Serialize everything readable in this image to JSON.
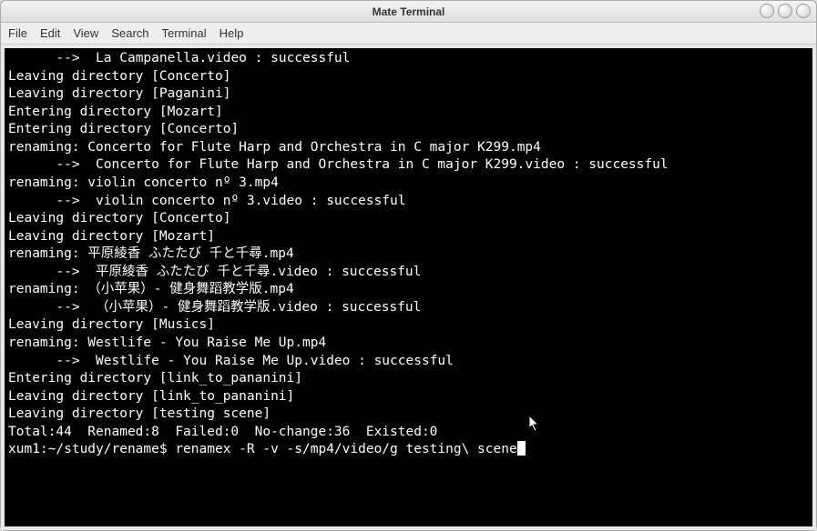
{
  "window": {
    "title": "Mate Terminal"
  },
  "menubar": {
    "file": "File",
    "edit": "Edit",
    "view": "View",
    "search": "Search",
    "terminal": "Terminal",
    "help": "Help"
  },
  "terminal": {
    "lines": [
      "      -->  La Campanella.video : successful",
      "Leaving directory [Concerto]",
      "Leaving directory [Paganini]",
      "Entering directory [Mozart]",
      "Entering directory [Concerto]",
      "renaming: Concerto for Flute Harp and Orchestra in C major K299.mp4",
      "      -->  Concerto for Flute Harp and Orchestra in C major K299.video : successful",
      "renaming: violin concerto nº 3.mp4",
      "      -->  violin concerto nº 3.video : successful",
      "Leaving directory [Concerto]",
      "Leaving directory [Mozart]",
      "renaming: 平原綾香 ふたたび 千と千尋.mp4",
      "      -->  平原綾香 ふたたび 千と千尋.video : successful",
      "renaming: （小苹果）- 健身舞蹈教学版.mp4",
      "      -->  （小苹果）- 健身舞蹈教学版.video : successful",
      "Leaving directory [Musics]",
      "renaming: Westlife - You Raise Me Up.mp4",
      "      -->  Westlife - You Raise Me Up.video : successful",
      "Entering directory [link_to_pananini]",
      "Leaving directory [link_to_pananini]",
      "Leaving directory [testing scene]",
      "Total:44  Renamed:8  Failed:0  No-change:36  Existed:0"
    ],
    "prompt": "xum1:~/study/rename$ ",
    "command": "renamex -R -v -s/mp4/video/g testing\\ scene"
  }
}
